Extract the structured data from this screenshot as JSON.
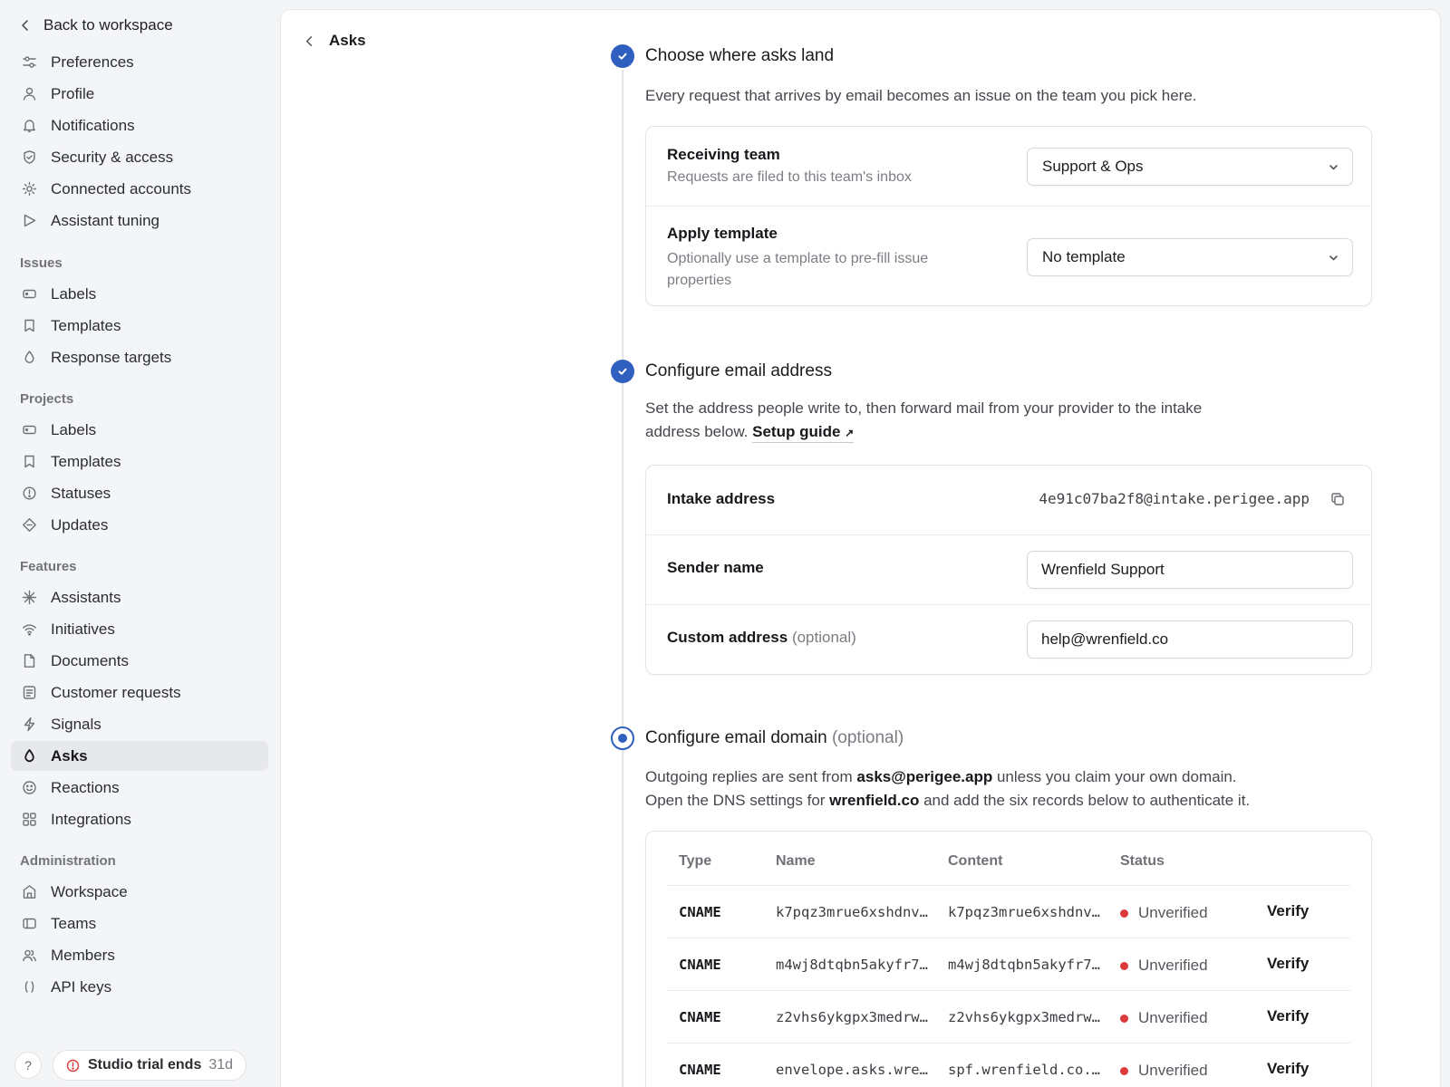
{
  "sidebar": {
    "back_label": "Back to workspace",
    "top_items": [
      {
        "label": "Preferences",
        "icon": "sliders-icon"
      },
      {
        "label": "Profile",
        "icon": "user-icon"
      },
      {
        "label": "Notifications",
        "icon": "bell-icon"
      },
      {
        "label": "Security & access",
        "icon": "shield-icon"
      },
      {
        "label": "Connected accounts",
        "icon": "sun-icon"
      },
      {
        "label": "Assistant tuning",
        "icon": "play-icon"
      }
    ],
    "sections": [
      {
        "title": "Issues",
        "items": [
          {
            "label": "Labels",
            "icon": "label-icon"
          },
          {
            "label": "Templates",
            "icon": "bookmark-icon"
          },
          {
            "label": "Response targets",
            "icon": "drop-icon"
          }
        ]
      },
      {
        "title": "Projects",
        "items": [
          {
            "label": "Labels",
            "icon": "label-icon"
          },
          {
            "label": "Templates",
            "icon": "bookmark-icon"
          },
          {
            "label": "Statuses",
            "icon": "status-icon"
          },
          {
            "label": "Updates",
            "icon": "diamond-icon"
          }
        ]
      },
      {
        "title": "Features",
        "items": [
          {
            "label": "Assistants",
            "icon": "asterisk-icon"
          },
          {
            "label": "Initiatives",
            "icon": "signal-icon"
          },
          {
            "label": "Documents",
            "icon": "document-icon"
          },
          {
            "label": "Customer requests",
            "icon": "request-icon"
          },
          {
            "label": "Signals",
            "icon": "bolt-icon"
          },
          {
            "label": "Asks",
            "icon": "drop-icon",
            "active": true
          },
          {
            "label": "Reactions",
            "icon": "smile-icon"
          },
          {
            "label": "Integrations",
            "icon": "grid-icon"
          }
        ]
      },
      {
        "title": "Administration",
        "items": [
          {
            "label": "Workspace",
            "icon": "building-icon"
          },
          {
            "label": "Teams",
            "icon": "teams-icon"
          },
          {
            "label": "Members",
            "icon": "members-icon"
          },
          {
            "label": "API keys",
            "icon": "code-icon"
          }
        ]
      }
    ],
    "help_label": "?",
    "trial_label": "Studio trial ends",
    "trial_days": "31d"
  },
  "header": {
    "title": "Asks"
  },
  "steps": {
    "landing": {
      "title": "Choose where asks land",
      "description": "Every request that arrives by email becomes an issue on the team you pick here.",
      "receiving_team_label": "Receiving team",
      "receiving_team_hint": "Requests are filed to this team's inbox",
      "receiving_team_value": "Support & Ops",
      "template_label": "Apply template",
      "template_hint": "Optionally use a template to pre-fill issue properties",
      "template_value": "No template"
    },
    "email": {
      "title": "Configure email address",
      "description_1": "Set the address people write to, then forward mail from your provider to the intake",
      "description_2": "address below.",
      "guide_label": "Setup guide",
      "guide_arrow": "↗",
      "intake_label": "Intake address",
      "intake_value": "4e91c07ba2f8@intake.perigee.app",
      "sender_label": "Sender name",
      "sender_value": "Wrenfield Support",
      "custom_label": "Custom address",
      "custom_optional": "(optional)",
      "custom_value": "help@wrenfield.co"
    },
    "domain": {
      "title": "Configure email domain",
      "title_optional": "(optional)",
      "line1_a": "Outgoing replies are sent from",
      "line1_b": "asks@perigee.app",
      "line1_c": "unless you claim your own domain.",
      "line2_a": "Open the DNS settings for",
      "line2_b": "wrenfield.co",
      "line2_c": "and add the six records below to authenticate it.",
      "columns": {
        "type": "Type",
        "name": "Name",
        "content": "Content",
        "status": "Status"
      },
      "records": [
        {
          "type": "CNAME",
          "name": "k7pqz3mrue6xshdnv…",
          "content": "k7pqz3mrue6xshdnv…",
          "status": "Unverified",
          "action": "Verify"
        },
        {
          "type": "CNAME",
          "name": "m4wj8dtqbn5akyfr7…",
          "content": "m4wj8dtqbn5akyfr7…",
          "status": "Unverified",
          "action": "Verify"
        },
        {
          "type": "CNAME",
          "name": "z2vhs6ykgpx3medrw…",
          "content": "z2vhs6ykgpx3medrw…",
          "status": "Unverified",
          "action": "Verify"
        },
        {
          "type": "CNAME",
          "name": "envelope.asks.wre…",
          "content": "spf.wrenfield.co.…",
          "status": "Unverified",
          "action": "Verify"
        }
      ]
    }
  },
  "colors": {
    "accent": "#2f5fbf",
    "status_unverified": "#dc3a3a",
    "sidebar_bg": "#f4f5f6",
    "active_item_bg": "#e7e8ea"
  }
}
